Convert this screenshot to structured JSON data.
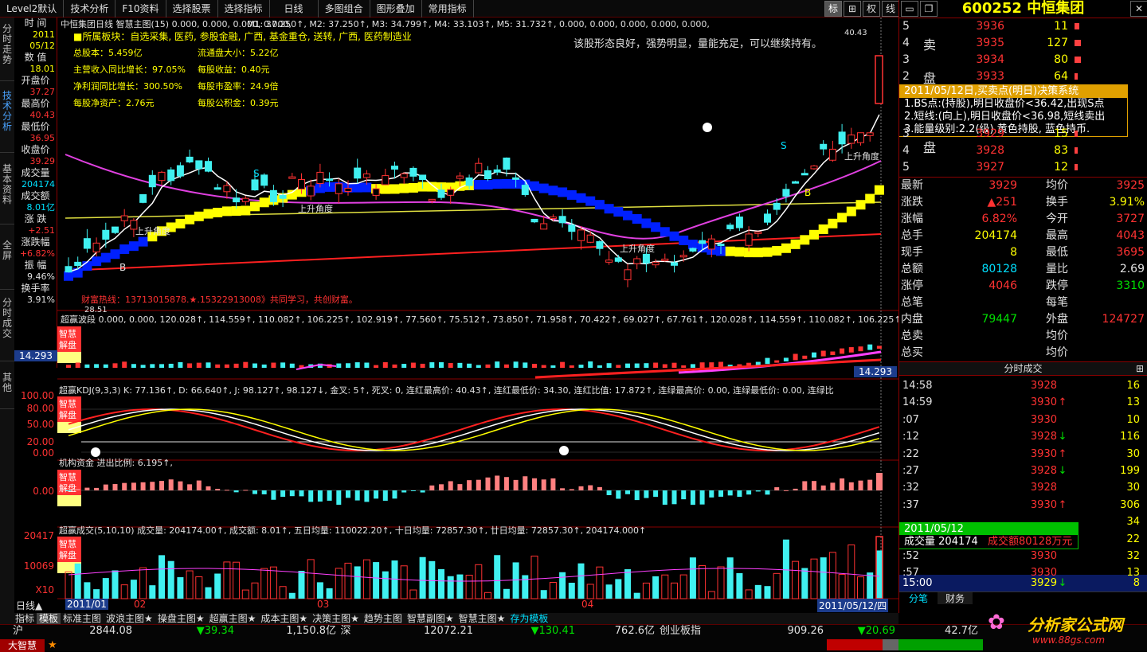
{
  "menu": [
    "Level2默认",
    "技术分析",
    "F10资料",
    "选择股票",
    "选择指标",
    "日线",
    "多图组合",
    "图形叠加",
    "常用指标"
  ],
  "toolbar": {
    "biao": "标",
    "grid": "⊞",
    "quan": "权",
    "xian": "线",
    "minimize": "▭",
    "close": "✕",
    "restore": "❐"
  },
  "vtabs": [
    "分时走势",
    "技术分析",
    "基本资料",
    "全屏",
    "分时成交",
    "其他"
  ],
  "leftinfo": [
    {
      "label": "时 间",
      "value": "2011",
      "value2": "05/12",
      "color": "#ffff00"
    },
    {
      "label": "数 值",
      "value": "18.01",
      "color": "#ffff00"
    },
    {
      "label": "开盘价",
      "value": "37.27",
      "color": "#ff3232"
    },
    {
      "label": "最高价",
      "value": "40.43",
      "color": "#ff3232"
    },
    {
      "label": "最低价",
      "value": "36.95",
      "color": "#ff3232"
    },
    {
      "label": "收盘价",
      "value": "39.29",
      "color": "#ff3232"
    },
    {
      "label": "成交量",
      "value": "204174",
      "color": "#00e0ff"
    },
    {
      "label": "成交额",
      "value": "8.01亿",
      "color": "#00e0ff"
    },
    {
      "label": "涨 跌",
      "value": "+2.51",
      "color": "#ff3232"
    },
    {
      "label": "涨跌幅",
      "value": "+6.82%",
      "color": "#ff3232"
    },
    {
      "label": "振 幅",
      "value": "9.46%",
      "color": "#e0e0e0"
    },
    {
      "label": "换手率",
      "value": "3.91%",
      "color": "#e0e0e0"
    }
  ],
  "main_chart": {
    "header": "中恒集团日线  智慧主图(15) 0.000, 0.000, 0.000, 0.000,",
    "ma_text": "M1: 37.250↑, M2: 37.250↑, M3: 34.799↑, M4: 33.103↑, M5: 31.732↑, 0.000, 0.000, 0.000, 0.000, 0.000,",
    "sector": "■所属板块：自选采集, 医药, 参股金融, 广西, 基金重仓, 送转, 广西, 医药制造业",
    "info": [
      [
        "总股本：5.459亿",
        "流通盘大小：5.22亿"
      ],
      [
        "主营收入同比增长：97.05%",
        "每股收益：0.40元"
      ],
      [
        "净利润同比增长：300.50%",
        "每股市盈率：24.9倍"
      ],
      [
        "每股净资产：2.76元",
        "每股公积金：0.39元"
      ]
    ],
    "comment": "该股形态良好，强势明显，量能充足，可以继续持有。",
    "hotline": "财富热线：13713015878.★.15322913008》共同学习，共创财富。",
    "high_label": "40.43",
    "low_label": "28.51",
    "angle_label": "上升角度",
    "y_right_label": "14.293"
  },
  "panel_bolang": {
    "header": "超赢波段 0.000, 0.000, 120.028↑, 114.559↑, 110.082↑, 106.225↑, 102.919↑, 77.560↑, 75.512↑, 73.850↑, 71.958↑, 70.422↑, 69.027↑, 67.761↑, 120.028↑, 114.559↑, 110.082↑, 106.225↑, 102",
    "left_value": "14.293"
  },
  "panel_kdj": {
    "header": "超赢KDJ(9,3,3) K: 77.136↑, D: 66.640↑, J: 98.127↑, 98.127↓, 金叉: 5↑, 死叉: 0, 连红最高价: 40.43↑, 连红最低价: 34.30, 连红比值: 17.872↑, 连绿最高价: 0.00, 连绿最低价: 0.00, 连绿比",
    "y_ticks": [
      "100.00",
      "80.00",
      "50.00",
      "20.00",
      "0.00"
    ]
  },
  "panel_jigou": {
    "header": "机构资金 进出比例: 6.195↑,",
    "y_tick": "0.00"
  },
  "panel_vol": {
    "header": "超赢成交(5,10,10) 成交量: 204174.00↑, 成交额: 8.01↑, 五日均量: 110022.20↑, 十日均量: 72857.30↑, 廿日均量: 72857.30↑, 204174.000↑",
    "y_ticks": [
      "20417",
      "10069",
      "X10"
    ]
  },
  "badge": [
    "智慧",
    "解盘"
  ],
  "date_axis": {
    "start": "2011/01",
    "m02": "02",
    "m03": "03",
    "m04": "04",
    "end": "2011/05/12/四"
  },
  "popup": {
    "title": "2011/05/12日,买卖点(明日)决策系统",
    "lines": [
      "1.BS点:(持股),明日收盘价<36.42,出现S点",
      "2.短线:(向上),明日收盘价<36.98,短线卖出",
      "3.能量级别:2.2(级),黄色持股, 蓝色持币."
    ]
  },
  "volpop": {
    "date": "2011/05/12",
    "vol_label": "成交量",
    "vol": "204174",
    "amt": "成交额80128万元"
  },
  "bottom_tabs": [
    "日线▲",
    "指标",
    "模板",
    "标准主图",
    "波浪主图★",
    "操盘主图★",
    "超赢主图★",
    "成本主图★",
    "决策主图★",
    "趋势主图",
    "智慧副图★",
    "智慧主图★",
    "存为模板"
  ],
  "right": {
    "code": "600252",
    "name": "中恒集团",
    "sell_label": "卖",
    "sell_label2": "盘",
    "buy_label": "盘",
    "sell": [
      [
        "5",
        "3936",
        "11"
      ],
      [
        "4",
        "3935",
        "127"
      ],
      [
        "3",
        "3934",
        "80"
      ],
      [
        "2",
        "3933",
        "64"
      ]
    ],
    "buy": [
      [
        "3",
        "3929",
        "15"
      ],
      [
        "4",
        "3928",
        "83"
      ],
      [
        "5",
        "3927",
        "12"
      ]
    ],
    "stats": [
      [
        "最新",
        "3929",
        "均价",
        "3925"
      ],
      [
        "涨跌",
        "▲251",
        "换手",
        "3.91%"
      ],
      [
        "涨幅",
        "6.82%",
        "今开",
        "3727"
      ],
      [
        "总手",
        "204174",
        "最高",
        "4043"
      ],
      [
        "现手",
        "8",
        "最低",
        "3695"
      ],
      [
        "总额",
        "80128",
        "量比",
        "2.69"
      ],
      [
        "涨停",
        "4046",
        "跌停",
        "3310"
      ],
      [
        "总笔",
        "",
        "每笔",
        ""
      ],
      [
        "内盘",
        "79447",
        "外盘",
        "124727"
      ],
      [
        "总卖",
        "",
        "均价",
        ""
      ],
      [
        "总买",
        "",
        "均价",
        ""
      ]
    ],
    "ticks_title": "分时成交",
    "ticks": [
      [
        "14:58",
        "3928",
        "",
        "16"
      ],
      [
        "14:59",
        "3930",
        "↑",
        "13"
      ],
      [
        ":07",
        "3930",
        "",
        "10"
      ],
      [
        ":12",
        "3928",
        "↓",
        "116"
      ],
      [
        ":22",
        "3930",
        "↑",
        "30"
      ],
      [
        ":27",
        "3928",
        "↓",
        "199"
      ],
      [
        ":32",
        "3928",
        "",
        "30"
      ],
      [
        ":37",
        "3930",
        "↑",
        "306"
      ],
      [
        "",
        "",
        "",
        "34"
      ],
      [
        "",
        "",
        "",
        "22"
      ],
      [
        ":52",
        "3930",
        "",
        "32"
      ],
      [
        ":57",
        "3930",
        "",
        "13"
      ]
    ],
    "last_tick": [
      "15:00",
      "3929",
      "↓",
      "8"
    ],
    "tabs": [
      "分笔",
      "财务"
    ]
  },
  "status": {
    "sh": "沪",
    "sh_idx": "2844.08",
    "sh_chg": "▼39.34",
    "sh_amt": "1,150.8亿",
    "sz": "深",
    "sz_idx": "12072.21",
    "sz_chg": "▼130.41",
    "sz_amt": "762.6亿",
    "cyb": "创业板指",
    "cyb_idx": "909.26",
    "cyb_chg": "▼20.69",
    "amt2": "42.7亿",
    "logo": "大智慧",
    "brand": "分析家公式网",
    "url": "www.88gs.com"
  }
}
